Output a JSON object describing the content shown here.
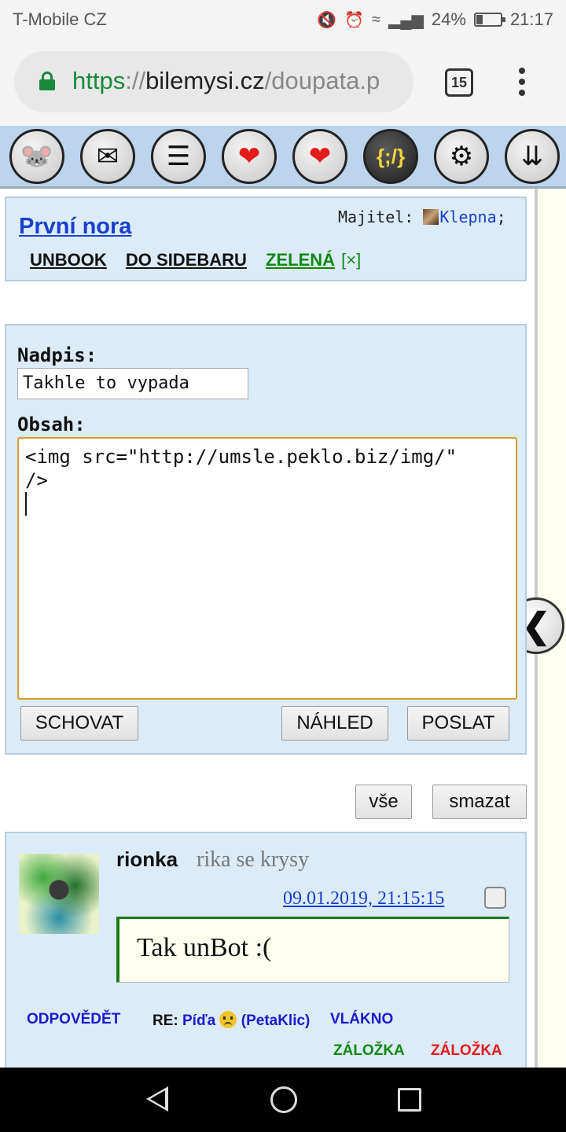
{
  "status": {
    "carrier": "T-Mobile CZ",
    "battery_percent": "24%",
    "battery_level": 0.24,
    "time": "21:17",
    "icons": [
      "mute-icon",
      "alarm-icon",
      "wifi-icon",
      "signal-icon"
    ]
  },
  "browser": {
    "url_scheme": "https",
    "url_sep": "://",
    "url_host": "bilemysi.cz",
    "url_path": "/doupata.p",
    "tab_count": "15"
  },
  "toolbar": {
    "buttons": [
      "mouse-logo",
      "mail-icon",
      "list-icon",
      "heart-icon",
      "heart-plus-icon",
      "code-icon",
      "tools-icon",
      "chevron-down-icon"
    ],
    "code_glyph": "{;/}"
  },
  "header": {
    "title": "První nora",
    "owner_label": "Majitel: ",
    "owner_name": "Klepna",
    "owner_suffix": ";",
    "link_unbook": "UNBOOK",
    "link_sidebar": "DO SIDEBARU",
    "link_green": "ZELENÁ",
    "link_close": "[×]"
  },
  "form": {
    "title_label": "Nadpis:",
    "title_value": "Takhle to vypada",
    "content_label": "Obsah:",
    "content_value": "<img src=\"http://umsle.peklo.biz/img/\"\n/>\n",
    "hide_button": "SCHOVAT",
    "preview_button": "NÁHLED",
    "send_button": "POSLAT"
  },
  "filters": {
    "all_button": "vše",
    "delete_button": "smazat"
  },
  "post": {
    "author": "rionka",
    "rank": "rika se krysy",
    "date": "09.01.2019, 21:15:15",
    "text": "Tak unBot :(",
    "reply": "ODPOVĚDĚT",
    "re_label": "RE: ",
    "re_name": "Píďa",
    "re_user": " (PetaKlic)",
    "thread": "VLÁKNO",
    "bookmark_green": "ZÁLOŽKA",
    "bookmark_red": "ZÁLOŽKA"
  }
}
